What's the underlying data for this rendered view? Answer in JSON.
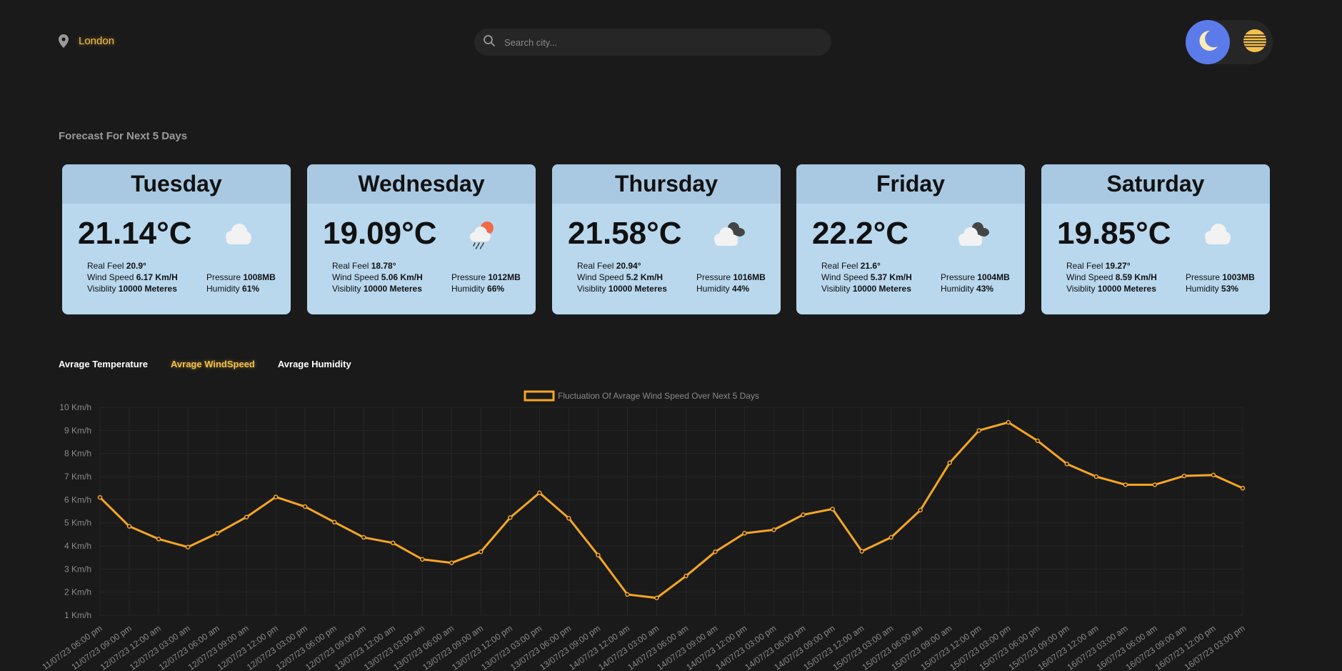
{
  "header": {
    "location": "London",
    "search_placeholder": "Search city...",
    "icons": {
      "location": "map-pin-icon",
      "search": "search-icon",
      "dark": "moon-icon",
      "light": "sun-icon"
    }
  },
  "forecast": {
    "title": "Forecast For Next 5 Days",
    "labels": {
      "real_feel": "Real Feel",
      "wind_speed": "Wind Speed",
      "visibility": "Visiblity",
      "pressure": "Pressure",
      "humidity": "Humidity"
    },
    "days": [
      {
        "day": "Tuesday",
        "temp": "21.14°C",
        "icon": "cloud-icon",
        "real_feel": "20.9°",
        "wind": "6.17 Km/H",
        "visibility": "10000 Meteres",
        "pressure": "1008MB",
        "humidity": "61%"
      },
      {
        "day": "Wednesday",
        "temp": "19.09°C",
        "icon": "sun-rain-cloud-icon",
        "real_feel": "18.78°",
        "wind": "5.06 Km/H",
        "visibility": "10000 Meteres",
        "pressure": "1012MB",
        "humidity": "66%"
      },
      {
        "day": "Thursday",
        "temp": "21.58°C",
        "icon": "dark-clouds-icon",
        "real_feel": "20.94°",
        "wind": "5.2 Km/H",
        "visibility": "10000 Meteres",
        "pressure": "1016MB",
        "humidity": "44%"
      },
      {
        "day": "Friday",
        "temp": "22.2°C",
        "icon": "dark-clouds-icon",
        "real_feel": "21.6°",
        "wind": "5.37 Km/H",
        "visibility": "10000 Meteres",
        "pressure": "1004MB",
        "humidity": "43%"
      },
      {
        "day": "Saturday",
        "temp": "19.85°C",
        "icon": "cloud-icon",
        "real_feel": "19.27°",
        "wind": "8.59 Km/H",
        "visibility": "10000 Meteres",
        "pressure": "1003MB",
        "humidity": "53%"
      }
    ]
  },
  "tabs": {
    "temperature": "Avrage Temperature",
    "windspeed": "Avrage WindSpeed",
    "humidity": "Avrage Humidity",
    "active": "windspeed"
  },
  "colors": {
    "background": "#1a1a1a",
    "accent": "#f5c04a",
    "line": "#f5a623",
    "card": "#b9d8ee",
    "card_header": "#a9c9e2",
    "toggle_active": "#5b7bea"
  },
  "chart_data": {
    "type": "line",
    "legend": "Fluctuation Of Avrage Wind Speed Over Next 5 Days",
    "legend_position": "top-center",
    "y_tick_labels": [
      "1 Km/h",
      "2 Km/h",
      "3 Km/h",
      "4 Km/h",
      "5 Km/h",
      "6 Km/h",
      "7 Km/h",
      "8 Km/h",
      "9 Km/h",
      "10 Km/h"
    ],
    "ylim": [
      1,
      10
    ],
    "grid": true,
    "x": [
      "11/07/23 06:00 pm",
      "11/07/23 09:00 pm",
      "12/07/23 12:00 am",
      "12/07/23 03:00 am",
      "12/07/23 06:00 am",
      "12/07/23 09:00 am",
      "12/07/23 12:00 pm",
      "12/07/23 03:00 pm",
      "12/07/23 06:00 pm",
      "12/07/23 09:00 pm",
      "13/07/23 12:00 am",
      "13/07/23 03:00 am",
      "13/07/23 06:00 am",
      "13/07/23 09:00 am",
      "13/07/23 12:00 pm",
      "13/07/23 03:00 pm",
      "13/07/23 06:00 pm",
      "13/07/23 09:00 pm",
      "14/07/23 12:00 am",
      "14/07/23 03:00 am",
      "14/07/23 06:00 am",
      "14/07/23 09:00 am",
      "14/07/23 12:00 pm",
      "14/07/23 03:00 pm",
      "14/07/23 06:00 pm",
      "14/07/23 09:00 pm",
      "15/07/23 12:00 am",
      "15/07/23 03:00 am",
      "15/07/23 06:00 am",
      "15/07/23 09:00 am",
      "15/07/23 12:00 pm",
      "15/07/23 03:00 pm",
      "15/07/23 06:00 pm",
      "15/07/23 09:00 pm",
      "16/07/23 12:00 am",
      "16/07/23 03:00 am",
      "16/07/23 06:00 am",
      "16/07/23 09:00 am",
      "16/07/23 12:00 pm",
      "16/07/23 03:00 pm"
    ],
    "values": [
      6.1,
      4.85,
      4.3,
      3.95,
      4.55,
      5.25,
      6.12,
      5.7,
      5.03,
      4.37,
      4.13,
      3.42,
      3.27,
      3.75,
      5.23,
      6.3,
      5.2,
      3.6,
      1.9,
      1.75,
      2.7,
      3.75,
      4.55,
      4.7,
      5.35,
      5.6,
      3.77,
      4.37,
      5.55,
      7.6,
      9.0,
      9.35,
      8.55,
      7.55,
      7.0,
      6.65,
      6.65,
      7.03,
      7.07,
      6.5
    ]
  }
}
